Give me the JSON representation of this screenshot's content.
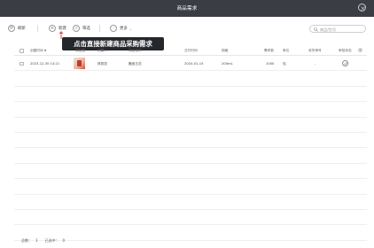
{
  "window": {
    "title": "商品需求"
  },
  "toolbar": {
    "refresh_label": "刷新",
    "new_label": "新建",
    "filter_label": "筛选",
    "more_label": "更多",
    "search_placeholder": "商品/货号"
  },
  "tooltip": {
    "text": "点击直接新建商品采购需求"
  },
  "table": {
    "columns": [
      "创建时间",
      "商品图",
      "创建人",
      "商品名称",
      "交付时间",
      "规格",
      "需求数",
      "单位",
      "收货单号",
      "审批状态"
    ],
    "rows": [
      {
        "created_at": "2023-12-30 14:21",
        "creator": "林张凯",
        "product_name": "脆皮五花",
        "delivery_date": "2024-01-15",
        "spec": "200mL",
        "quantity": "1000",
        "unit": "包",
        "receipt_no": "-",
        "status_icon": "check-circle-icon"
      }
    ],
    "empty_rows": 11
  },
  "footer": {
    "total_label": "总数：",
    "total_value": "1",
    "selected_label": "已选中：",
    "selected_value": "0"
  },
  "colors": {
    "titlebar": "#3b3d45",
    "tooltip": "#24272c",
    "arrow": "#d9534f"
  }
}
